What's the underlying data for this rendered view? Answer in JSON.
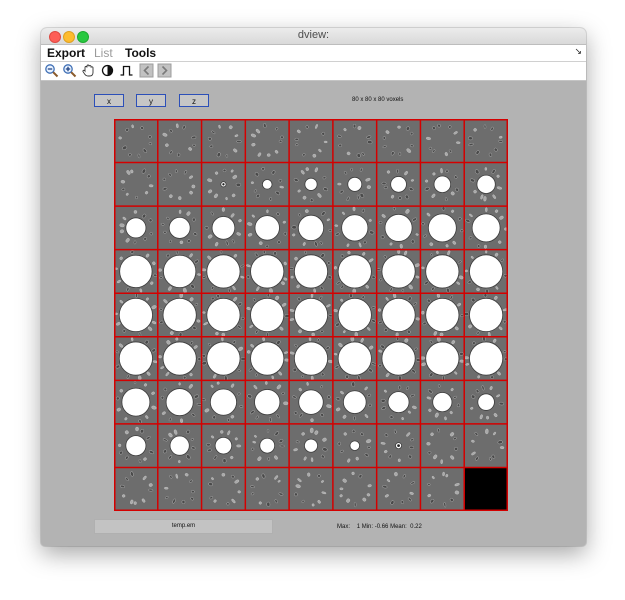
{
  "window": {
    "title": "dview:"
  },
  "menu": {
    "export": "Export",
    "list": "List",
    "tools": "Tools"
  },
  "toolbar": {
    "icons": [
      "zoom-out-icon",
      "zoom-in-icon",
      "hand-pan-icon",
      "contrast-icon",
      "pulse-icon",
      "previous-icon",
      "next-icon"
    ]
  },
  "axis_buttons": {
    "x": "x",
    "y": "y",
    "z": "z"
  },
  "volume": {
    "dims_label": "80 x 80 x 80 voxels"
  },
  "montage": {
    "rows": 9,
    "cols": 9,
    "frame_color": "#d40000",
    "tile_bg": "#6d6d6d",
    "blob_color": "#ffffff",
    "blob_radius": [
      [
        0,
        0,
        0,
        0,
        0,
        0,
        0,
        0,
        0
      ],
      [
        0,
        0,
        0.12,
        0.22,
        0.28,
        0.32,
        0.36,
        0.38,
        0.42
      ],
      [
        0.46,
        0.48,
        0.52,
        0.56,
        0.58,
        0.6,
        0.62,
        0.64,
        0.64
      ],
      [
        0.74,
        0.74,
        0.76,
        0.76,
        0.76,
        0.76,
        0.76,
        0.76,
        0.76
      ],
      [
        0.76,
        0.76,
        0.76,
        0.76,
        0.76,
        0.76,
        0.76,
        0.76,
        0.76
      ],
      [
        0.76,
        0.76,
        0.76,
        0.76,
        0.76,
        0.76,
        0.76,
        0.76,
        0.76
      ],
      [
        0.64,
        0.62,
        0.6,
        0.58,
        0.56,
        0.52,
        0.48,
        0.44,
        0.38
      ],
      [
        0.46,
        0.44,
        0.38,
        0.34,
        0.3,
        0.22,
        0.14,
        0,
        0
      ],
      [
        0,
        0,
        0,
        0,
        0,
        0,
        0,
        0,
        0
      ]
    ],
    "ring_tiles": [
      [
        1,
        2
      ],
      [
        7,
        6
      ]
    ],
    "empty_tile": [
      8,
      8
    ]
  },
  "status": {
    "filename": "temp.em",
    "max_label": "Max:",
    "max_value": "1",
    "min_label": "Min:",
    "min_value": "-0.66",
    "mean_label": "Mean:",
    "mean_value": "0.22"
  }
}
